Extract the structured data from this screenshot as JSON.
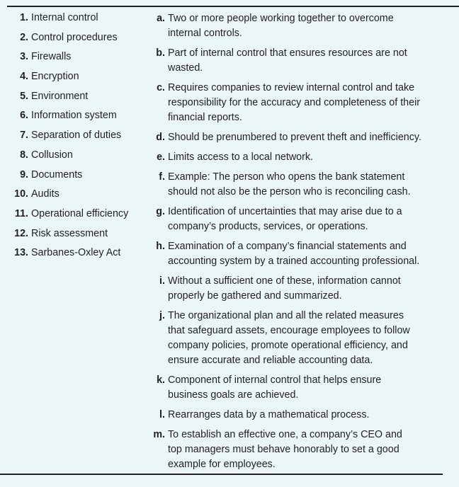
{
  "terms": [
    {
      "num": "1.",
      "label": "Internal control"
    },
    {
      "num": "2.",
      "label": "Control procedures"
    },
    {
      "num": "3.",
      "label": "Firewalls"
    },
    {
      "num": "4.",
      "label": "Encryption"
    },
    {
      "num": "5.",
      "label": "Environment"
    },
    {
      "num": "6.",
      "label": "Information system"
    },
    {
      "num": "7.",
      "label": "Separation of duties"
    },
    {
      "num": "8.",
      "label": "Collusion"
    },
    {
      "num": "9.",
      "label": "Documents"
    },
    {
      "num": "10.",
      "label": "Audits"
    },
    {
      "num": "11.",
      "label": "Operational efficiency"
    },
    {
      "num": "12.",
      "label": "Risk assessment"
    },
    {
      "num": "13.",
      "label": "Sarbanes-Oxley Act"
    }
  ],
  "definitions": [
    {
      "letter": "a.",
      "text": "Two or more people working together to overcome\ninternal controls."
    },
    {
      "letter": "b.",
      "text": "Part of internal control that ensures resources are not\nwasted."
    },
    {
      "letter": "c.",
      "text": "Requires companies to review internal control and take\nresponsibility for the accuracy and completeness of their\nfinancial reports."
    },
    {
      "letter": "d.",
      "text": "Should be prenumbered to prevent theft and inefficiency."
    },
    {
      "letter": "e.",
      "text": "Limits access to a local network."
    },
    {
      "letter": "f.",
      "text": "Example: The person who opens the bank statement\nshould not also be the person who is reconciling cash."
    },
    {
      "letter": "g.",
      "text": "Identification of uncertainties that may arise due to a\ncompany’s products, services, or operations."
    },
    {
      "letter": "h.",
      "text": "Examination of a company’s financial statements and\naccounting system by a trained accounting professional."
    },
    {
      "letter": "i.",
      "text": "Without a sufficient one of these, information cannot\nproperly be gathered and summarized."
    },
    {
      "letter": "j.",
      "text": "The organizational plan and all the related measures\nthat safeguard assets, encourage employees to follow\ncompany policies, promote operational efficiency, and\nensure accurate and reliable accounting data."
    },
    {
      "letter": "k.",
      "text": "Component of internal control that helps ensure\nbusiness goals are achieved."
    },
    {
      "letter": "l.",
      "text": "Rearranges data by a mathematical process."
    },
    {
      "letter": "m.",
      "text": "To establish an effective one, a company’s CEO and\ntop managers must behave honorably to set a good\nexample for employees."
    }
  ]
}
